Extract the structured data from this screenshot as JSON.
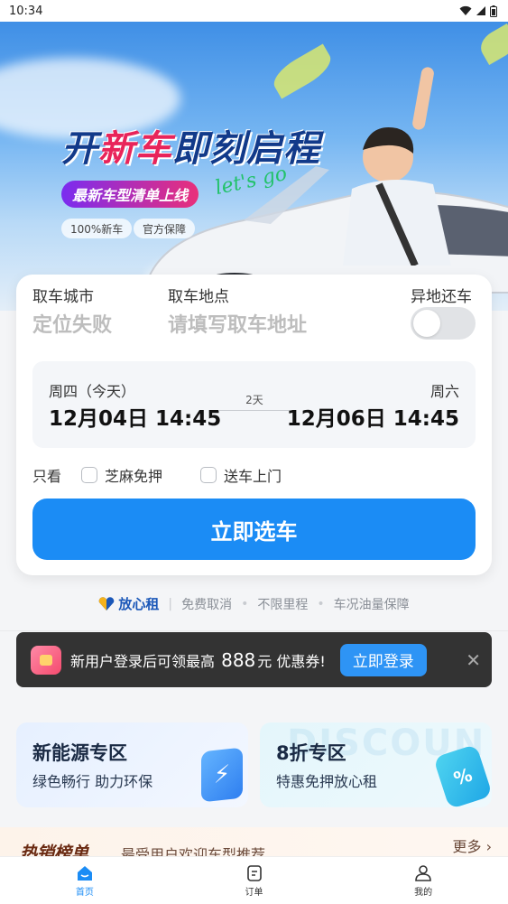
{
  "status_bar": {
    "time": "10:34"
  },
  "hero": {
    "title_part1": "开",
    "title_part2": "新车",
    "title_part3": "即刻启程",
    "subtitle": "最新车型清单上线",
    "script": "let's go",
    "chips": [
      "100%新车",
      "官方保障"
    ]
  },
  "booking": {
    "pickup_city_label": "取车城市",
    "pickup_city_value": "定位失败",
    "pickup_location_label": "取车地点",
    "pickup_location_placeholder": "请填写取车地址",
    "return_elsewhere_label": "异地还车",
    "return_elsewhere_on": false,
    "start_weekday": "周四（今天）",
    "start_date": "12月04日  14:45",
    "end_weekday": "周六",
    "end_date": "12月06日  14:45",
    "duration": "2天",
    "filter_label": "只看",
    "filter_options": [
      "芝麻免押",
      "送车上门"
    ],
    "cta": "立即选车"
  },
  "trust": {
    "brand": "放心租",
    "items": [
      "免费取消",
      "不限里程",
      "车况油量保障"
    ]
  },
  "login_banner": {
    "text_before": "新用户登录后可领最高",
    "amount": "888",
    "text_after": "元 优惠券!",
    "button": "立即登录",
    "close": "✕"
  },
  "promos": [
    {
      "title": "新能源专区",
      "subtitle": "绿色畅行 助力环保"
    },
    {
      "title": "8折专区",
      "subtitle": "特惠免押放心租",
      "bg_text": "DISCOUN"
    }
  ],
  "hot_list": {
    "title": "热销榜单",
    "subtitle": "最受用户欢迎车型推荐",
    "more": "更多"
  },
  "tabs": [
    {
      "label": "首页",
      "active": true
    },
    {
      "label": "订单",
      "active": false
    },
    {
      "label": "我的",
      "active": false
    }
  ],
  "colors": {
    "primary": "#1b8cf5",
    "banner_bg": "#333333"
  }
}
